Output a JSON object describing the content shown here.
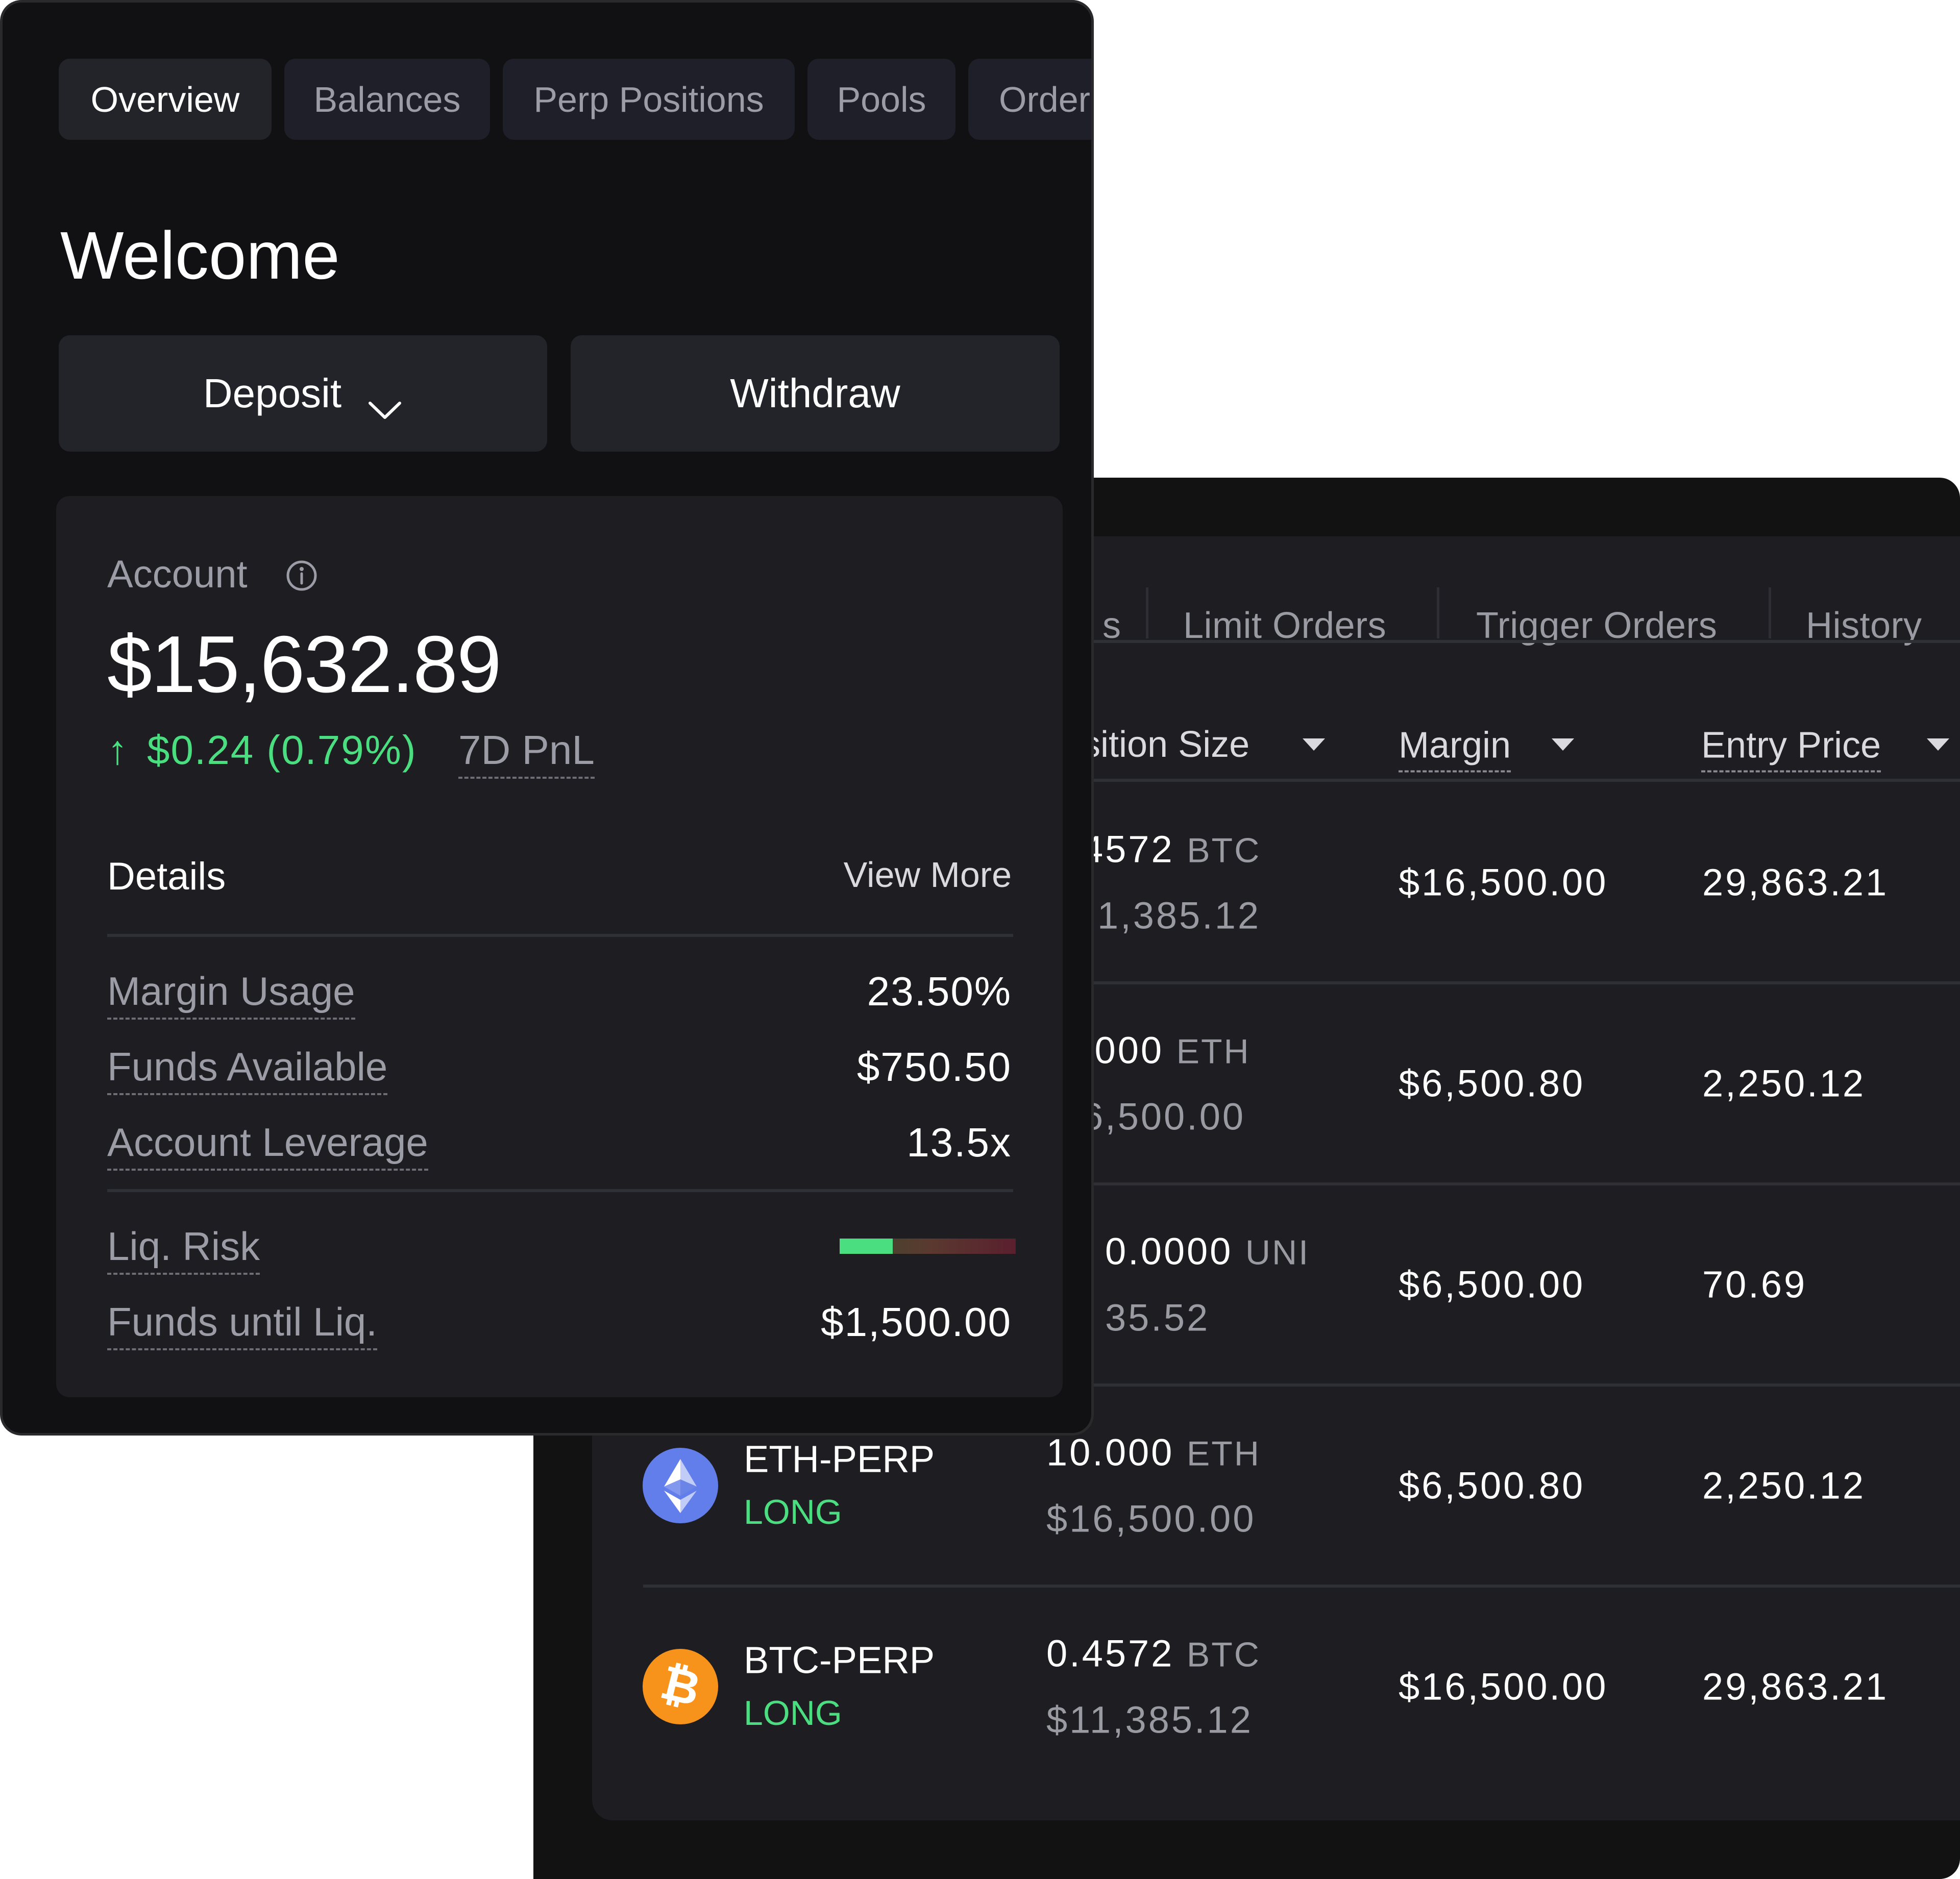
{
  "front": {
    "tabs": [
      {
        "label": "Overview",
        "active": true
      },
      {
        "label": "Balances",
        "active": false
      },
      {
        "label": "Perp Positions",
        "active": false
      },
      {
        "label": "Pools",
        "active": false
      },
      {
        "label": "Orders",
        "active": false
      }
    ],
    "welcome": "Welcome",
    "deposit_label": "Deposit",
    "withdraw_label": "Withdraw",
    "account": {
      "label": "Account",
      "value": "$15,632.89",
      "pnl_arrow": "↑",
      "pnl_value": "$0.24 (0.79%)",
      "pnl_label": "7D PnL"
    },
    "details": {
      "title": "Details",
      "view_more": "View More",
      "rows": [
        {
          "label": "Margin Usage",
          "value": "23.50%"
        },
        {
          "label": "Funds Available",
          "value": "$750.50"
        },
        {
          "label": "Account Leverage",
          "value": "13.5x"
        }
      ],
      "liq_risk_label": "Liq. Risk",
      "liq_risk_level": 0.3,
      "funds_until_liq_label": "Funds until Liq.",
      "funds_until_liq_value": "$1,500.00"
    }
  },
  "back": {
    "tabs": [
      {
        "label": "s"
      },
      {
        "label": "Limit Orders"
      },
      {
        "label": "Trigger Orders"
      },
      {
        "label": "History"
      }
    ],
    "columns": [
      {
        "label": "sition Size"
      },
      {
        "label": "Margin"
      },
      {
        "label": "Entry Price"
      }
    ],
    "rows": [
      {
        "market": "",
        "side": "",
        "coin": "",
        "size": "4572",
        "size_unit": "BTC",
        "size_usd": "1,385.12",
        "margin": "$16,500.00",
        "entry": "29,863.21"
      },
      {
        "market": "",
        "side": "",
        "coin": "",
        "size": ".000",
        "size_unit": "ETH",
        "size_usd": "6,500.00",
        "margin": "$6,500.80",
        "entry": "2,250.12"
      },
      {
        "market": "",
        "side": "",
        "coin": "",
        "size": "0.0000",
        "size_unit": "UNI",
        "size_usd": "35.52",
        "margin": "$6,500.00",
        "entry": "70.69"
      },
      {
        "market": "ETH-PERP",
        "side": "LONG",
        "coin": "eth",
        "size": "10.000",
        "size_unit": "ETH",
        "size_usd": "$16,500.00",
        "margin": "$6,500.80",
        "entry": "2,250.12"
      },
      {
        "market": "BTC-PERP",
        "side": "LONG",
        "coin": "btc",
        "size": "0.4572",
        "size_unit": "BTC",
        "size_usd": "$11,385.12",
        "margin": "$16,500.00",
        "entry": "29,863.21"
      }
    ]
  },
  "colors": {
    "positive": "#4ade80",
    "eth": "#627eea",
    "btc": "#f7931a",
    "background": "#111113",
    "card": "#1d1d22"
  }
}
